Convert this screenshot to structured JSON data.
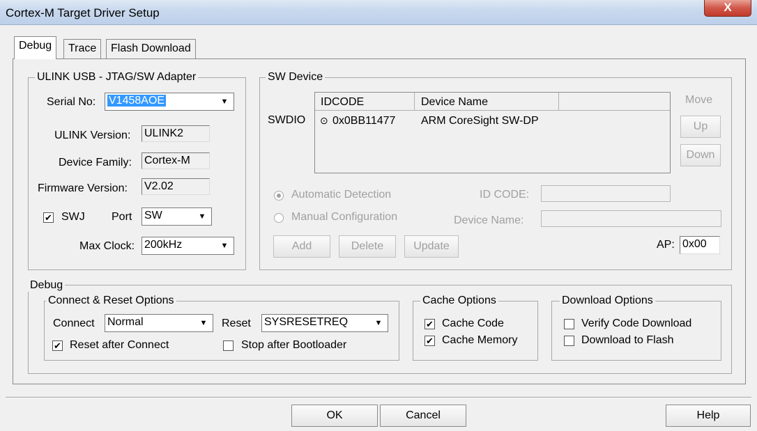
{
  "window": {
    "title": "Cortex-M Target Driver Setup",
    "close": "X"
  },
  "tabs": [
    "Debug",
    "Trace",
    "Flash Download"
  ],
  "adapter": {
    "group_label": "ULINK USB - JTAG/SW Adapter",
    "serial_label": "Serial No:",
    "serial_value": "V1458AOE",
    "version_label": "ULINK Version:",
    "version_value": "ULINK2",
    "family_label": "Device Family:",
    "family_value": "Cortex-M",
    "firmware_label": "Firmware Version:",
    "firmware_value": "V2.02",
    "swj_label": "SWJ",
    "swj_checked": true,
    "port_label": "Port",
    "port_value": "SW",
    "clock_label": "Max Clock:",
    "clock_value": "200kHz"
  },
  "sw_device": {
    "group_label": "SW Device",
    "row_label": "SWDIO",
    "col_idcode": "IDCODE",
    "col_name": "Device Name",
    "row_idcode": "0x0BB11477",
    "row_name": "ARM CoreSight SW-DP",
    "move_label": "Move",
    "up_label": "Up",
    "down_label": "Down",
    "auto_label": "Automatic Detection",
    "manual_label": "Manual Configuration",
    "idcode_label": "ID CODE:",
    "devname_label": "Device Name:",
    "add_label": "Add",
    "delete_label": "Delete",
    "update_label": "Update",
    "ap_label": "AP:",
    "ap_value": "0x00"
  },
  "debug": {
    "group_label": "Debug",
    "connect_group": "Connect & Reset Options",
    "connect_label": "Connect",
    "connect_value": "Normal",
    "reset_label": "Reset",
    "reset_value": "SYSRESETREQ",
    "reset_after_label": "Reset after Connect",
    "reset_after_checked": true,
    "stop_after_label": "Stop after Bootloader",
    "stop_after_checked": false,
    "cache_group": "Cache Options",
    "cache_code_label": "Cache Code",
    "cache_code_checked": true,
    "cache_mem_label": "Cache Memory",
    "cache_mem_checked": true,
    "download_group": "Download Options",
    "verify_label": "Verify Code Download",
    "verify_checked": false,
    "flash_label": "Download to Flash",
    "flash_checked": false
  },
  "footer": {
    "ok": "OK",
    "cancel": "Cancel",
    "help": "Help"
  },
  "icons": {
    "dropdown": "chevron-down-icon",
    "check": "check-icon",
    "close": "close-icon"
  }
}
